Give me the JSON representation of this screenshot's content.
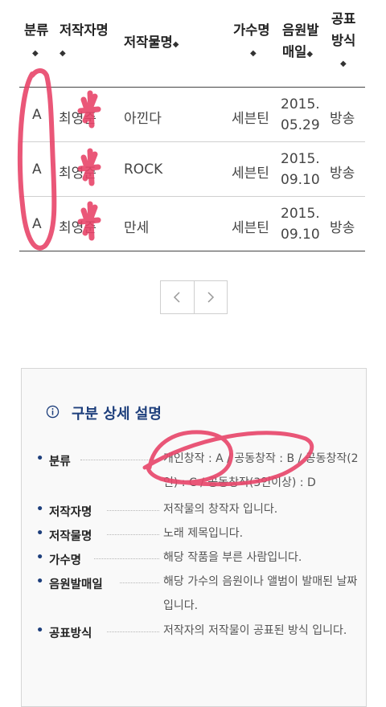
{
  "table": {
    "headers": {
      "category": "분류",
      "writer": "저작자명",
      "work": "저작물명",
      "singer": "가수명",
      "release_line1": "음원발",
      "release_line2": "매일",
      "method_line1": "공표",
      "method_line2": "방식"
    },
    "sort_icon": "◆",
    "rows": [
      {
        "category": "A",
        "writer": "최영준",
        "work": "아낀다",
        "singer": "세븐틴",
        "date_line1": "2015.",
        "date_line2": "05.29",
        "method": "방송"
      },
      {
        "category": "A",
        "writer": "최영준",
        "work": "ROCK",
        "singer": "세븐틴",
        "date_line1": "2015.",
        "date_line2": "09.10",
        "method": "방송"
      },
      {
        "category": "A",
        "writer": "최영준",
        "work": "만세",
        "singer": "세븐틴",
        "date_line1": "2015.",
        "date_line2": "09.10",
        "method": "방송"
      }
    ]
  },
  "pagination": {
    "prev_icon": "chevron-left-icon",
    "next_icon": "chevron-right-icon"
  },
  "info": {
    "title": "구분 상세 설명",
    "icon": "info-icon",
    "definitions": [
      {
        "term": "분류",
        "desc": "개인창작 : A / 공동창작 : B / 공동창작(2인) : C / 공동창작(3인이상) : D"
      },
      {
        "term": "저작자명",
        "desc": "저작물의 창작자 입니다."
      },
      {
        "term": "저작물명",
        "desc": "노래 제목입니다."
      },
      {
        "term": "가수명",
        "desc": "해당 작품을 부른 사람입니다."
      },
      {
        "term": "음원발매일",
        "desc": "해당 가수의 음원이나 앨범이 발매된 날짜입니다."
      },
      {
        "term": "공표방식",
        "desc": "저작자의 저작물이 공표된 방식 입니다."
      }
    ]
  },
  "colors": {
    "title_blue": "#1e3f7c",
    "marker": "#e8456a"
  }
}
